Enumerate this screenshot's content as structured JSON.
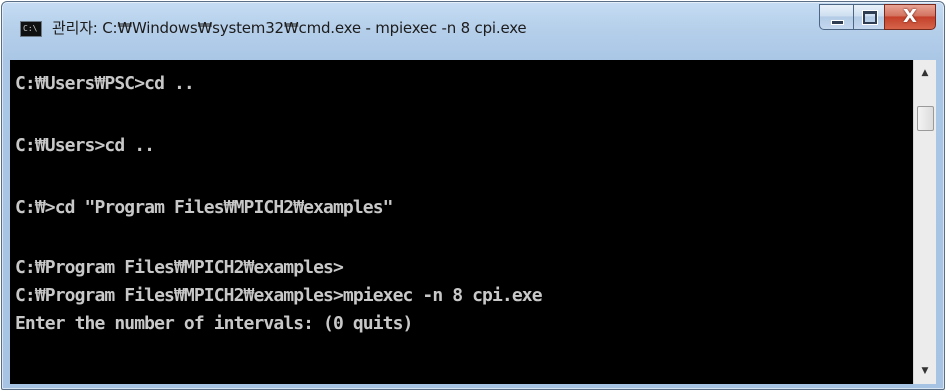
{
  "window": {
    "title": "관리자: C:₩Windows₩system32₩cmd.exe - mpiexec  -n 8 cpi.exe",
    "icon": "console-icon",
    "controls": {
      "minimize": "minimize-icon",
      "maximize": "maximize-icon",
      "close_glyph": "X"
    }
  },
  "console": {
    "lines": [
      "C:₩Users₩PSC>cd ..",
      "",
      "C:₩Users>cd ..",
      "",
      "C:₩>cd \"Program Files₩MPICH2₩examples\"",
      "",
      "C:₩Program Files₩MPICH2₩examples>",
      "C:₩Program Files₩MPICH2₩examples>mpiexec -n 8 cpi.exe",
      "Enter the number of intervals: (0 quits)"
    ]
  },
  "scrollbar": {
    "up_arrow": "▲",
    "down_arrow": "▼"
  },
  "colors": {
    "console_background": "#000000",
    "console_text": "#c8c8c8",
    "titlebar": "#b5cfea",
    "close_button": "#c4402a"
  }
}
